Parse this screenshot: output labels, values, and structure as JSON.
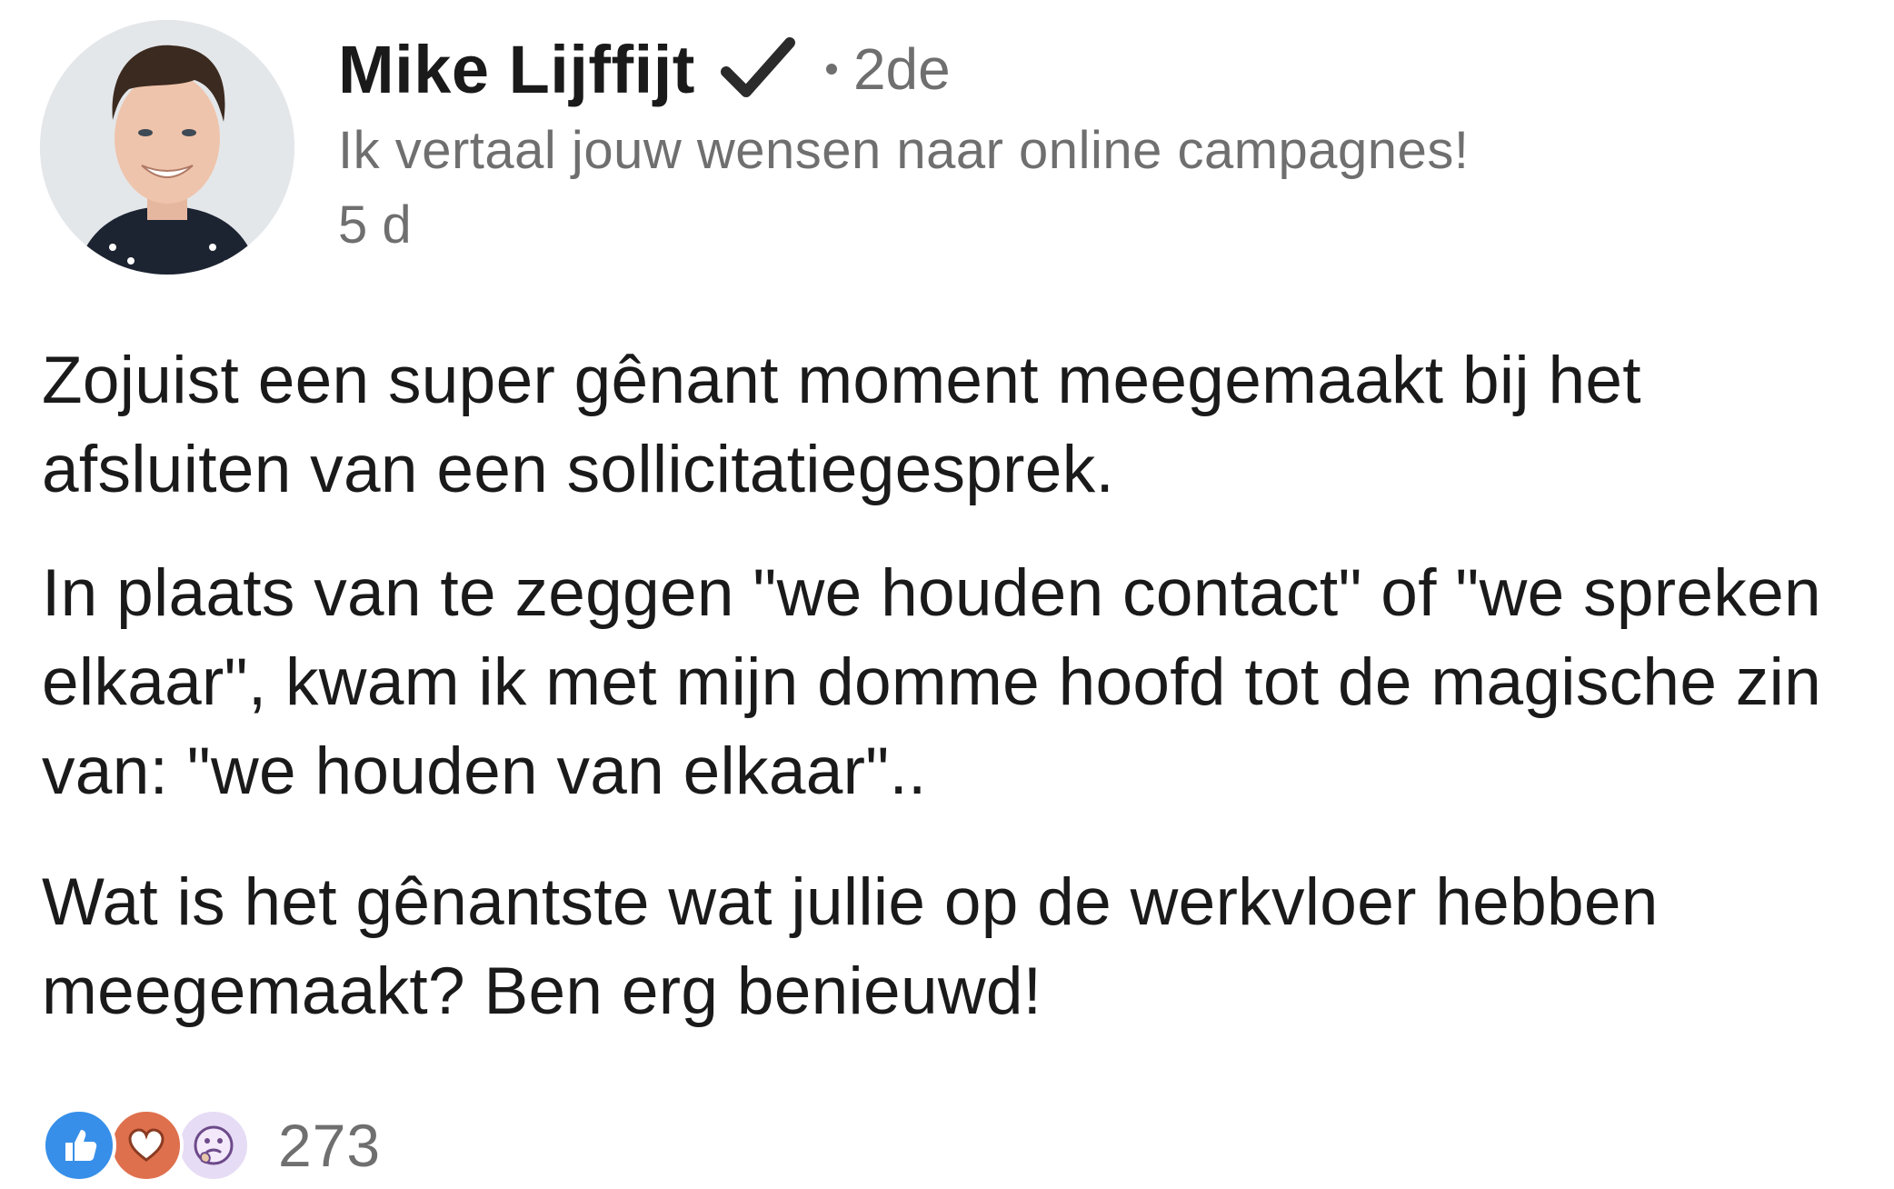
{
  "author": {
    "name": "Mike Lijffijt",
    "connection_degree": "2de",
    "headline": "Ik vertaal jouw wensen naar online campagnes!",
    "time_ago": "5 d",
    "verified_icon": "check-mark-icon",
    "avatar_icon": "profile-photo"
  },
  "post": {
    "paragraphs": [
      "Zojuist een super gênant moment meegemaakt bij het afsluiten van een sollicitatiegesprek.",
      "In plaats van te zeggen \"we houden contact\" of \"we spreken elkaar\", kwam ik met mijn domme hoofd tot de magische zin van: \"we houden van elkaar\"..",
      "Wat is het gênantste wat jullie op de werkvloer hebben meegemaakt? Ben erg benieuwd!"
    ]
  },
  "reactions": {
    "types": [
      "like-icon",
      "love-icon",
      "curious-icon"
    ],
    "count": "273",
    "colors": {
      "like": "#378fe9",
      "love": "#df704d",
      "curious": "#e6dcf5"
    }
  }
}
